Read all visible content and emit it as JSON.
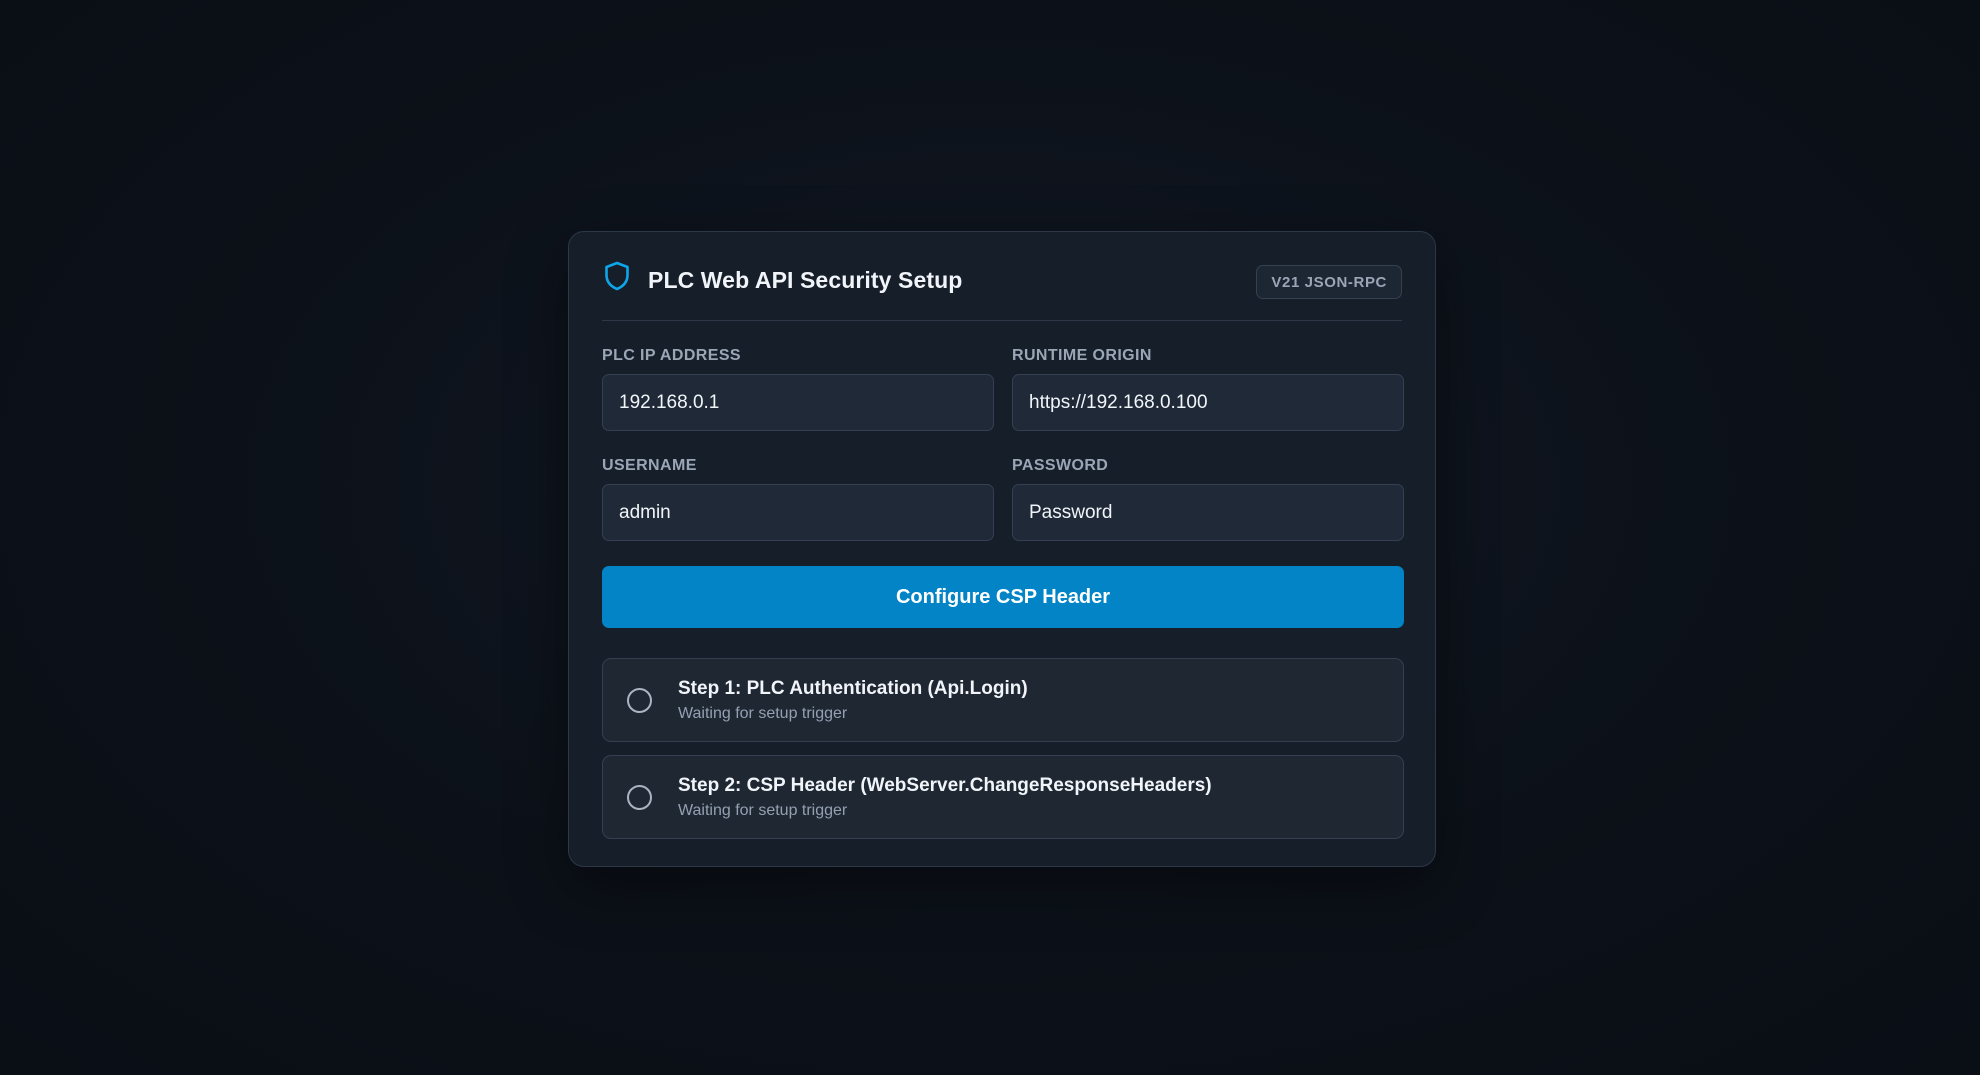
{
  "header": {
    "title": "PLC Web API Security Setup",
    "badge": "V21 JSON-RPC",
    "icon": "shield-icon"
  },
  "fields": {
    "plc_ip": {
      "label": "PLC IP ADDRESS",
      "value": "192.168.0.1"
    },
    "runtime_origin": {
      "label": "RUNTIME ORIGIN",
      "value": "https://192.168.0.100"
    },
    "username": {
      "label": "USERNAME",
      "value": "admin"
    },
    "password": {
      "label": "PASSWORD",
      "placeholder": "Password"
    }
  },
  "configure_button": {
    "label": "Configure CSP Header"
  },
  "steps": [
    {
      "title": "Step 1: PLC Authentication (Api.Login)",
      "status": "Waiting for setup trigger"
    },
    {
      "title": "Step 2: CSP Header (WebServer.ChangeResponseHeaders)",
      "status": "Waiting for setup trigger"
    }
  ],
  "colors": {
    "accent": "#0284c7",
    "shield": "#0ea5e9",
    "card_bg": "#161e2a",
    "page_bg": "#0c1018"
  }
}
